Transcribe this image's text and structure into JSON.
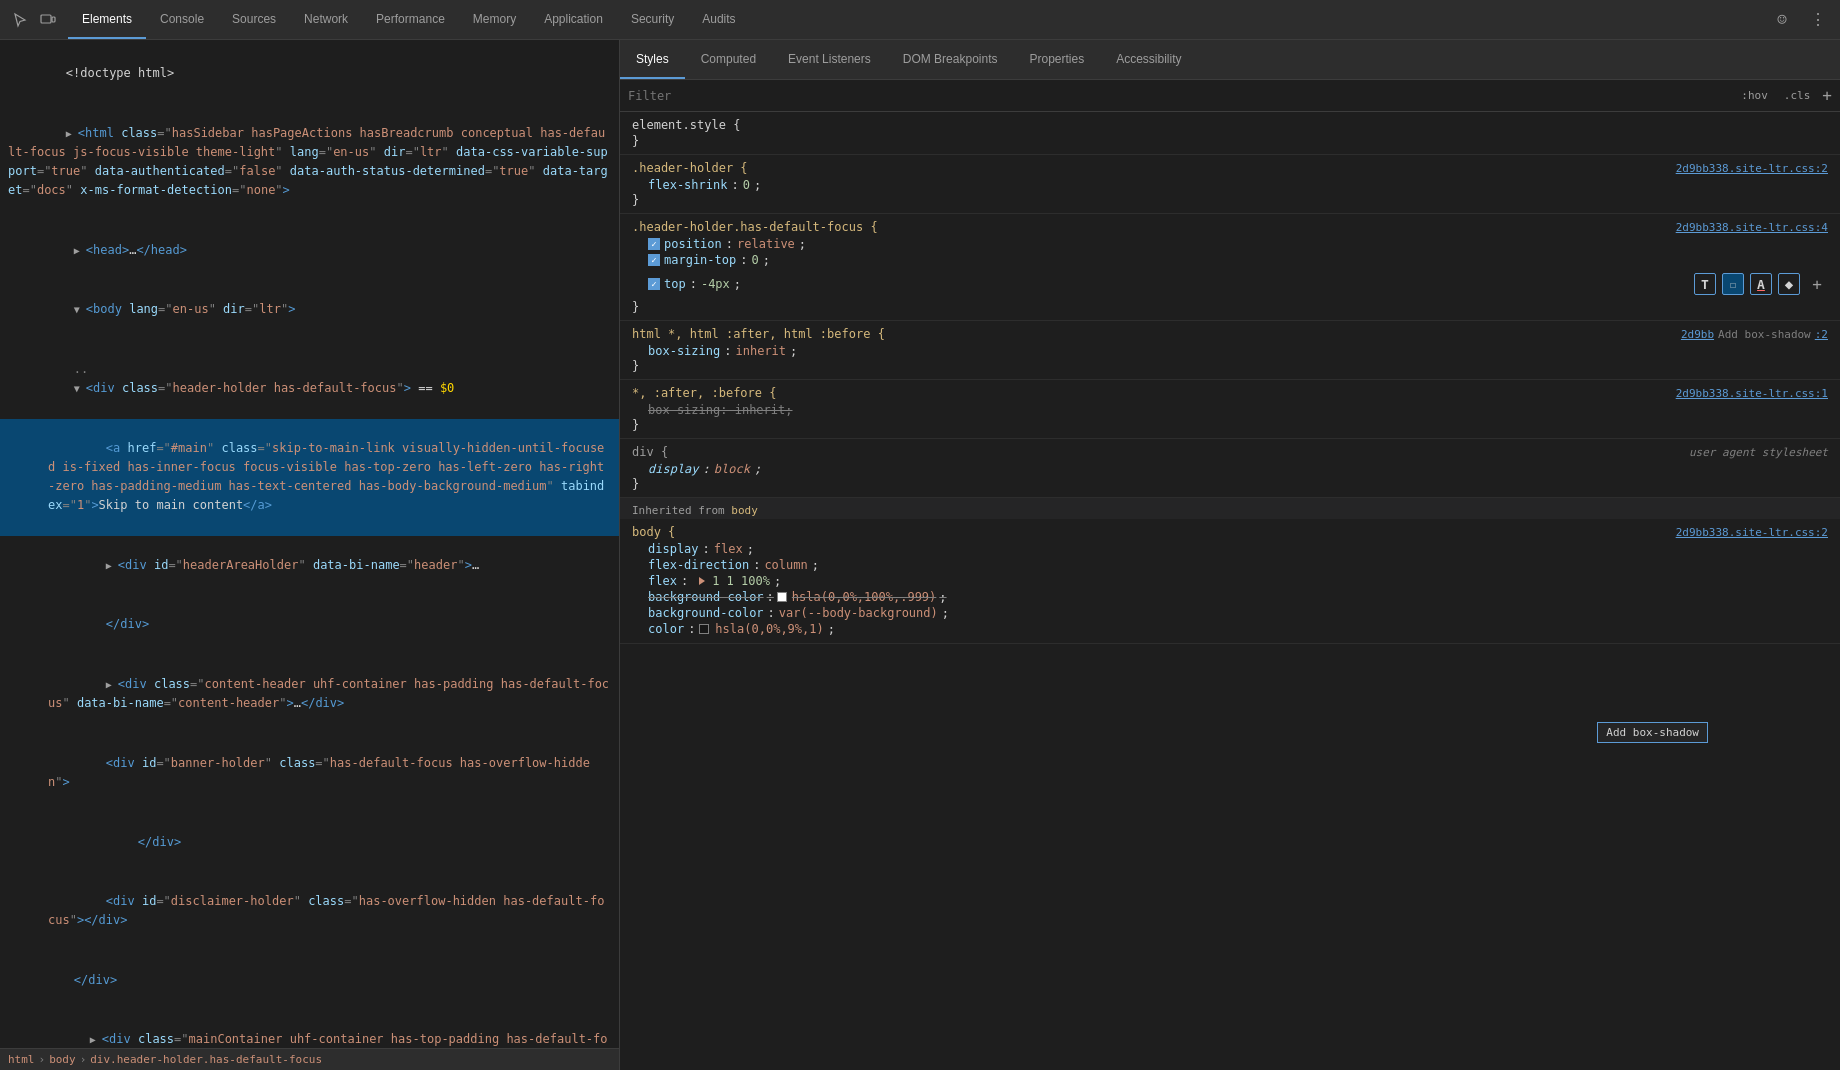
{
  "toolbar": {
    "tabs": [
      {
        "label": "Elements",
        "active": true
      },
      {
        "label": "Console",
        "active": false
      },
      {
        "label": "Sources",
        "active": false
      },
      {
        "label": "Network",
        "active": false
      },
      {
        "label": "Performance",
        "active": false
      },
      {
        "label": "Memory",
        "active": false
      },
      {
        "label": "Application",
        "active": false
      },
      {
        "label": "Security",
        "active": false
      },
      {
        "label": "Audits",
        "active": false
      }
    ]
  },
  "styles_tabs": [
    {
      "label": "Styles",
      "active": true
    },
    {
      "label": "Computed",
      "active": false
    },
    {
      "label": "Event Listeners",
      "active": false
    },
    {
      "label": "DOM Breakpoints",
      "active": false
    },
    {
      "label": "Properties",
      "active": false
    },
    {
      "label": "Accessibility",
      "active": false
    }
  ],
  "filter": {
    "placeholder": "Filter",
    "hov": ":hov",
    "cls": ".cls"
  },
  "breadcrumb": {
    "items": [
      "html",
      "body",
      "div.header-holder.has-default-focus"
    ]
  },
  "css_rules": [
    {
      "id": "element_style",
      "selector": "element.style {",
      "close": "}",
      "source": null,
      "props": []
    },
    {
      "id": "header_holder",
      "selector": ".header-holder {",
      "close": "}",
      "source": "2d9bb338.site-ltr.css:2",
      "props": [
        {
          "checked": false,
          "name": "flex-shrink",
          "value": "0",
          "strikethrough": false
        }
      ]
    },
    {
      "id": "header_holder_focus",
      "selector": ".header-holder.has-default-focus {",
      "close": "}",
      "source": "2d9bb338.site-ltr.css:4",
      "props": [
        {
          "checked": true,
          "name": "position",
          "value": "relative",
          "strikethrough": false
        },
        {
          "checked": true,
          "name": "margin-top",
          "value": "0",
          "strikethrough": false
        },
        {
          "checked": true,
          "name": "top",
          "value": "-4px",
          "strikethrough": false
        }
      ],
      "tools": true
    },
    {
      "id": "html_all",
      "selector": "html *, html :after, html :before {",
      "close": "}",
      "source": "2d9bb    Add box-shadow    :2",
      "source_main": "2d9bb",
      "source_tooltip": "Add box-shadow",
      "source_end": ":2",
      "props": [
        {
          "checked": false,
          "name": "box-sizing",
          "value": "inherit",
          "strikethrough": false
        }
      ]
    },
    {
      "id": "all_pseudo",
      "selector": "*, :after, :before {",
      "close": "}",
      "source": "2d9bb338.site-ltr.css:1",
      "props": [
        {
          "checked": false,
          "name": "box-sizing",
          "value": "inherit",
          "strikethrough": true
        }
      ]
    },
    {
      "id": "div_ua",
      "selector": "div {",
      "close": "}",
      "source": "user agent stylesheet",
      "user_agent": true,
      "props": [
        {
          "checked": false,
          "name": "display",
          "value": "block",
          "strikethrough": false,
          "italic": true
        }
      ]
    },
    {
      "id": "inherited_label",
      "label": "Inherited from body"
    },
    {
      "id": "body_inherited",
      "selector": "body {",
      "close": "}",
      "source": "2d9bb338.site-ltr.css:2",
      "props": [
        {
          "checked": false,
          "name": "display",
          "value": "flex",
          "strikethrough": false
        },
        {
          "checked": false,
          "name": "flex-direction",
          "value": "column",
          "strikethrough": false
        },
        {
          "checked": false,
          "name": "flex",
          "value": "",
          "triangle": true,
          "triangle_value": "1 1 100%",
          "strikethrough": false
        },
        {
          "checked": false,
          "name": "background-color",
          "value": "hsla(0,0%,100%,.999)",
          "swatch": "white",
          "strikethrough": true
        },
        {
          "checked": false,
          "name": "background-color",
          "value": "var(--body-background)",
          "strikethrough": false
        },
        {
          "checked": false,
          "name": "color",
          "value": "hsla(0,0%,9%,1)",
          "swatch": "#171717",
          "strikethrough": false,
          "partial": true
        }
      ]
    }
  ]
}
